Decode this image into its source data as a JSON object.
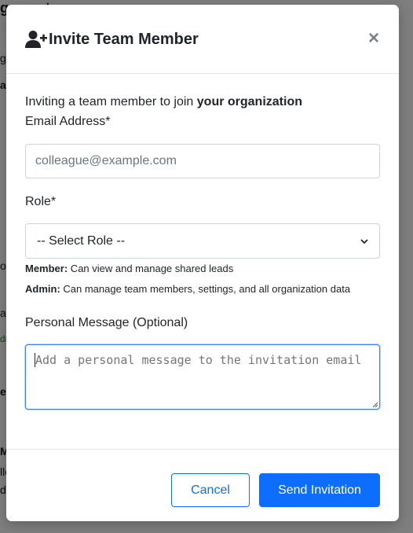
{
  "background_page": {
    "fragments": [
      "gement",
      "g",
      "a",
      "or",
      "a",
      "dr",
      "er",
      "M",
      "llc",
      "d"
    ]
  },
  "modal": {
    "title": "Invite Team Member",
    "title_icon": "user-plus-icon",
    "close_label": "×",
    "intro": {
      "text": "Inviting a team member to join ",
      "emphasis": "your organization"
    },
    "email": {
      "label": "Email Address*",
      "placeholder": "colleague@example.com",
      "value": ""
    },
    "role": {
      "label": "Role*",
      "selected": "-- Select Role --",
      "help": [
        {
          "name": "Member:",
          "text": " Can view and manage shared leads"
        },
        {
          "name": "Admin:",
          "text": " Can manage team members, settings, and all organization data"
        }
      ]
    },
    "message": {
      "label": "Personal Message (Optional)",
      "placeholder": "Add a personal message to the invitation email",
      "value": ""
    },
    "buttons": {
      "cancel": "Cancel",
      "send": "Send Invitation"
    }
  },
  "colors": {
    "primary": "#0d6efd",
    "overlay": "rgba(0,0,0,0.5)",
    "focus_border": "#3b82f6"
  }
}
